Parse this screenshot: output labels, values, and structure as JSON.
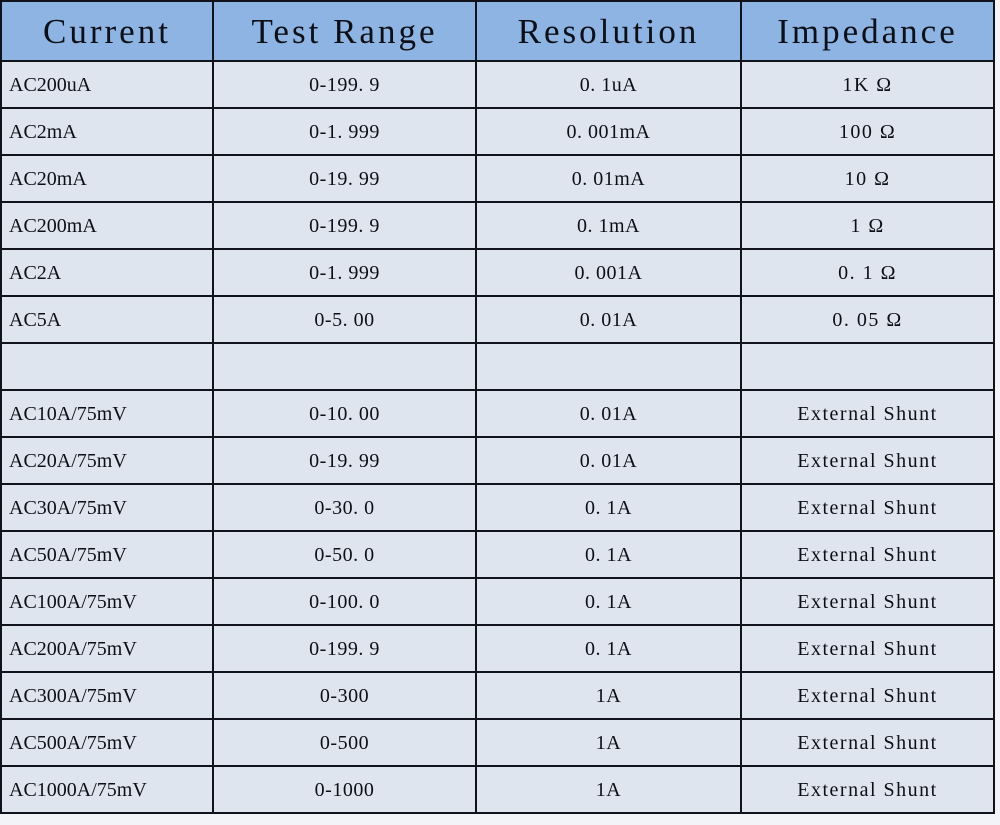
{
  "table": {
    "name": "ac-current-ranges",
    "columns": [
      {
        "key": "current",
        "label": "Current"
      },
      {
        "key": "range",
        "label": "Test Range"
      },
      {
        "key": "resolution",
        "label": "Resolution"
      },
      {
        "key": "impedance",
        "label": "Impedance"
      }
    ],
    "colors": {
      "header_background": "#8db4e2",
      "cell_background": "#dfe5ee",
      "border": "#11131c",
      "text": "#0d0f16",
      "page_background": "#f2f4f7"
    },
    "rows": [
      {
        "current": "AC200uA",
        "range": "0-199. 9",
        "resolution": "0. 1uA",
        "impedance": "1K Ω"
      },
      {
        "current": "AC2mA",
        "range": "0-1. 999",
        "resolution": "0. 001mA",
        "impedance": "100 Ω"
      },
      {
        "current": "AC20mA",
        "range": "0-19. 99",
        "resolution": "0. 01mA",
        "impedance": "10 Ω"
      },
      {
        "current": "AC200mA",
        "range": "0-199. 9",
        "resolution": "0. 1mA",
        "impedance": "1 Ω"
      },
      {
        "current": "AC2A",
        "range": "0-1. 999",
        "resolution": "0. 001A",
        "impedance": "0. 1 Ω"
      },
      {
        "current": "AC5A",
        "range": "0-5. 00",
        "resolution": "0. 01A",
        "impedance": "0. 05 Ω"
      },
      {
        "current": "",
        "range": "",
        "resolution": "",
        "impedance": ""
      },
      {
        "current": "AC10A/75mV",
        "range": "0-10. 00",
        "resolution": "0. 01A",
        "impedance": "External Shunt"
      },
      {
        "current": "AC20A/75mV",
        "range": "0-19. 99",
        "resolution": "0. 01A",
        "impedance": "External Shunt"
      },
      {
        "current": "AC30A/75mV",
        "range": "0-30. 0",
        "resolution": "0. 1A",
        "impedance": "External Shunt"
      },
      {
        "current": "AC50A/75mV",
        "range": "0-50. 0",
        "resolution": "0. 1A",
        "impedance": "External Shunt"
      },
      {
        "current": "AC100A/75mV",
        "range": "0-100. 0",
        "resolution": "0. 1A",
        "impedance": "External Shunt"
      },
      {
        "current": "AC200A/75mV",
        "range": "0-199. 9",
        "resolution": "0. 1A",
        "impedance": "External Shunt"
      },
      {
        "current": "AC300A/75mV",
        "range": "0-300",
        "resolution": "1A",
        "impedance": "External Shunt"
      },
      {
        "current": "AC500A/75mV",
        "range": "0-500",
        "resolution": "1A",
        "impedance": "External Shunt"
      },
      {
        "current": "AC1000A/75mV",
        "range": "0-1000",
        "resolution": "1A",
        "impedance": "External Shunt"
      }
    ]
  }
}
